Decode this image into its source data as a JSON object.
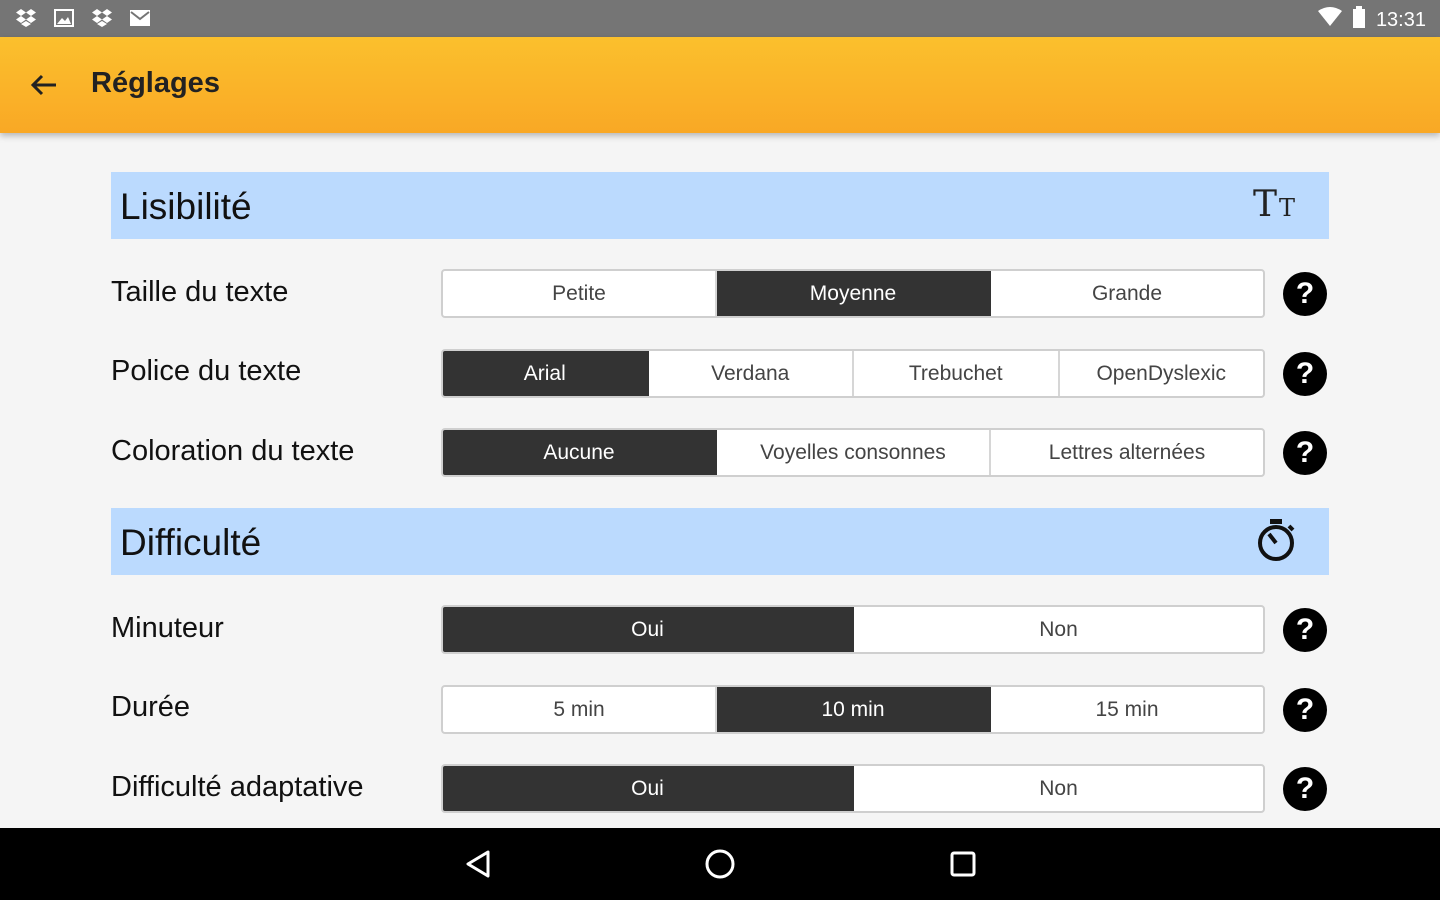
{
  "status_bar": {
    "icons": [
      "dropbox-icon",
      "image-icon",
      "dropbox-icon",
      "mail-icon"
    ],
    "time": "13:31"
  },
  "app_bar": {
    "title": "Réglages",
    "back_icon": "arrow-back-icon"
  },
  "sections": {
    "lisibilite": {
      "title": "Lisibilité",
      "icon": "text-size-icon",
      "icon_text": "TT",
      "rows": {
        "taille": {
          "label": "Taille du texte",
          "options": [
            "Petite",
            "Moyenne",
            "Grande"
          ],
          "selected": "Moyenne"
        },
        "police": {
          "label": "Police du texte",
          "options": [
            "Arial",
            "Verdana",
            "Trebuchet",
            "OpenDyslexic"
          ],
          "selected": "Arial"
        },
        "coloration": {
          "label": "Coloration du texte",
          "options": [
            "Aucune",
            "Voyelles consonnes",
            "Lettres alternées"
          ],
          "selected": "Aucune"
        }
      }
    },
    "difficulte": {
      "title": "Difficulté",
      "icon": "stopwatch-icon",
      "rows": {
        "minuteur": {
          "label": "Minuteur",
          "options": [
            "Oui",
            "Non"
          ],
          "selected": "Oui"
        },
        "duree": {
          "label": "Durée",
          "options": [
            "5 min",
            "10 min",
            "15 min"
          ],
          "selected": "10 min"
        },
        "adaptative": {
          "label": "Difficulté adaptative",
          "options": [
            "Oui",
            "Non"
          ],
          "selected": "Oui"
        }
      }
    }
  },
  "help_glyph": "?",
  "colors": {
    "app_bar": "#f9a825",
    "section_header": "#bbdafe",
    "selected": "#333333"
  }
}
